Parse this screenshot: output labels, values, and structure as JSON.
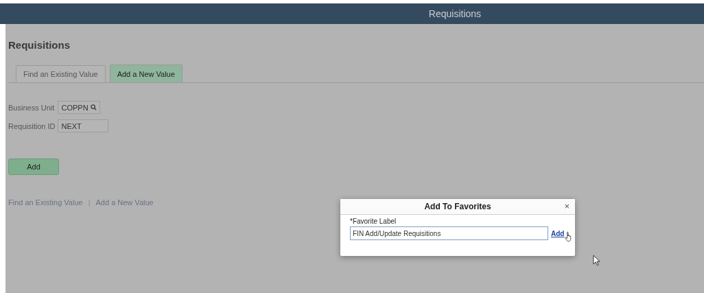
{
  "header": {
    "title": "Requisitions"
  },
  "page": {
    "title": "Requisitions"
  },
  "tabs": [
    {
      "label": "Find an Existing Value",
      "selected": false
    },
    {
      "label": "Add a New Value",
      "selected": true
    }
  ],
  "fields": [
    {
      "label": "Business Unit",
      "value": "COPPN",
      "kind": "lookup"
    },
    {
      "label": "Requisition ID",
      "value": "NEXT",
      "kind": "text"
    }
  ],
  "add_button": "Add",
  "footer_links": [
    {
      "label": "Find an Existing Value"
    },
    {
      "label": "Add a New Value"
    }
  ],
  "footer_separator": "|",
  "dialog": {
    "title": "Add To Favorites",
    "close": "×",
    "field_label": "*Favorite Label",
    "field_value": "FIN Add/Update Requisitions",
    "action": "Add"
  }
}
